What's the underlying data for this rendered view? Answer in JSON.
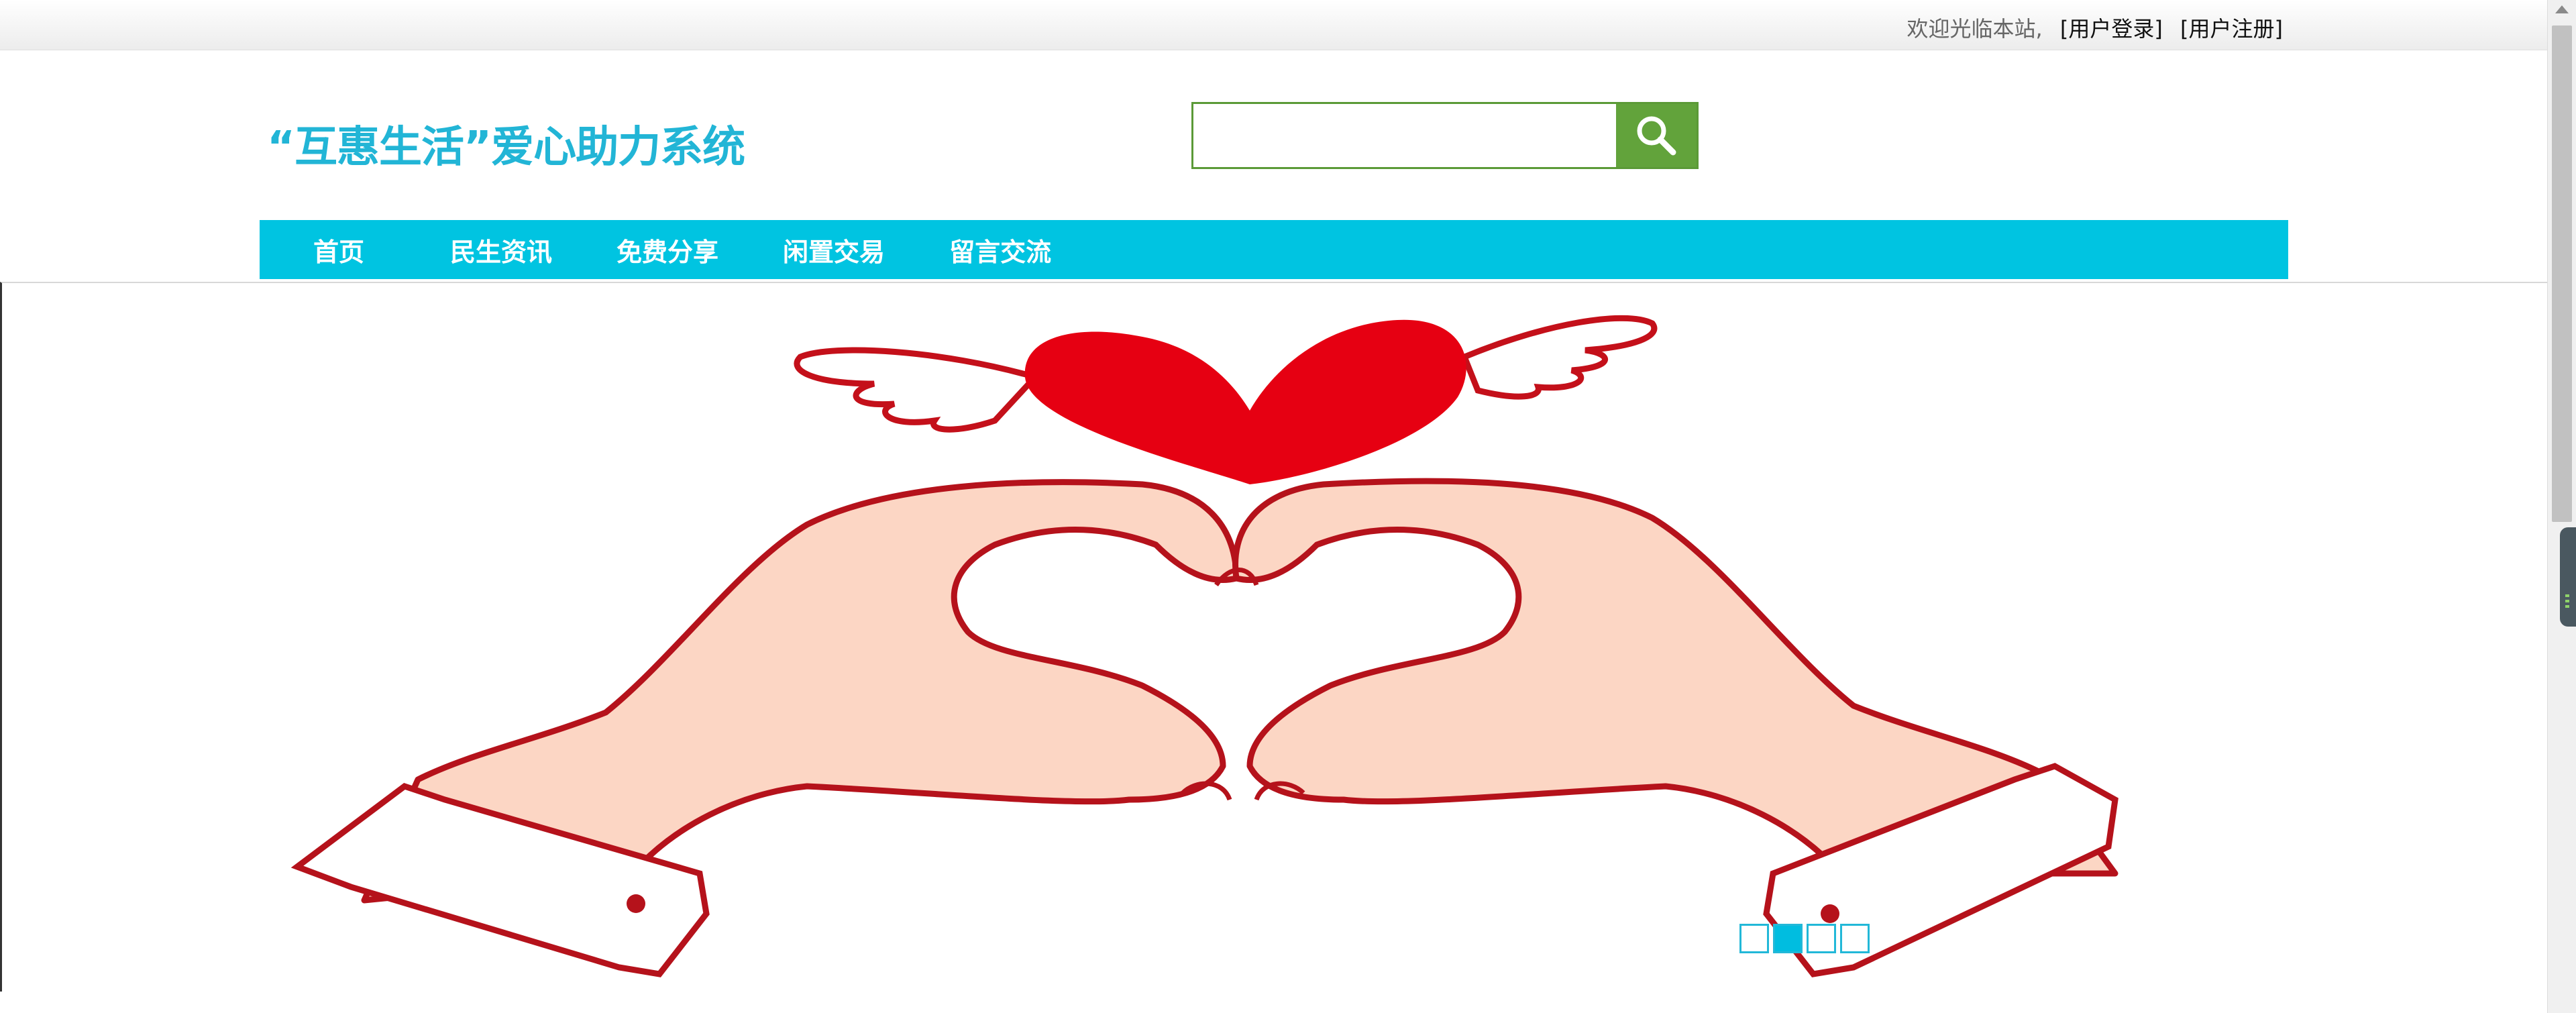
{
  "topbar": {
    "welcome": "欢迎光临本站,",
    "login": "[用户登录]",
    "register": "[用户注册]"
  },
  "header": {
    "logo": "“互惠生活”爱心助力系统",
    "search": {
      "value": "",
      "placeholder": ""
    }
  },
  "nav": {
    "items": [
      {
        "label": "首页"
      },
      {
        "label": "民生资讯"
      },
      {
        "label": "免费分享"
      },
      {
        "label": "闲置交易"
      },
      {
        "label": "留言交流"
      }
    ]
  },
  "banner": {
    "image": "heart-hands-illustration",
    "slides_total": 4,
    "active_slide": 2
  },
  "colors": {
    "brand": "#22b5d6",
    "nav_bg": "#00c4e1",
    "search_accent": "#62a33b",
    "heart": "#e60012",
    "skin": "#fcd6c4",
    "outline": "#b5121b"
  },
  "icons": {
    "search": "search-icon"
  }
}
